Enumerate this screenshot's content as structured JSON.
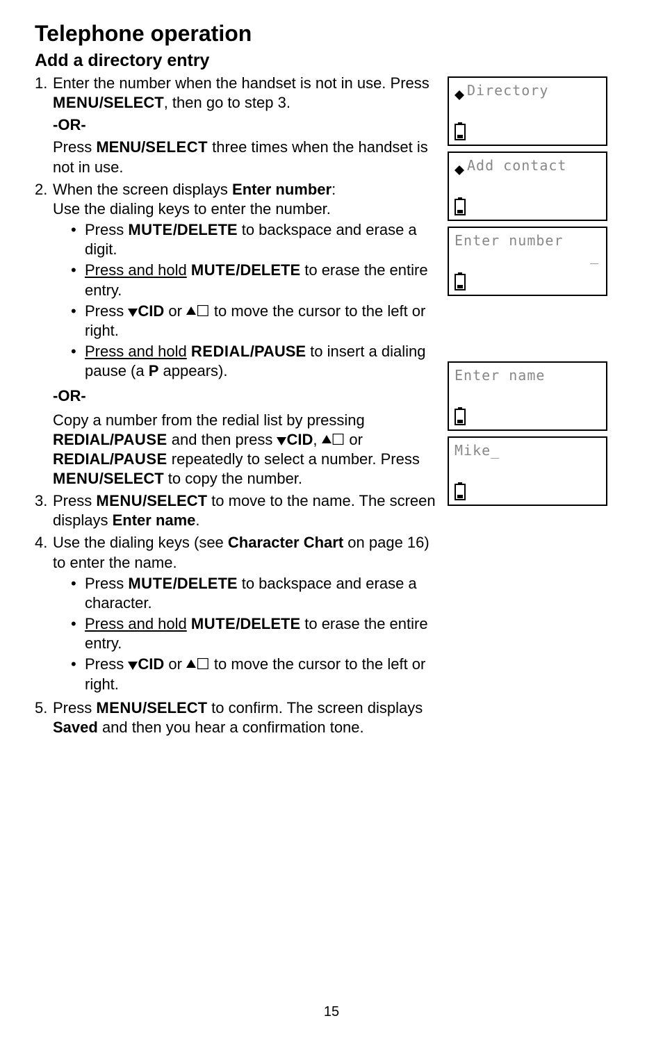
{
  "title": "Telephone operation",
  "section": "Add a directory entry",
  "steps": {
    "s1": {
      "num": "1.",
      "text_a": "Enter the number when the handset is not in use. Press ",
      "text_b": ", then go to step 3.",
      "menu_select_sc": "MENU",
      "menu_select_b": "/SELECT"
    },
    "or": "-OR-",
    "press_line_a": "Press ",
    "press_line_b": " three times when the handset is not in use.",
    "menu_b2": "MENU/",
    "menu_sc2": "SELECT",
    "s2": {
      "num": "2.",
      "text_a": "When the screen displays ",
      "text_b": ":",
      "enter_number": "Enter number",
      "use_keys": "Use the dialing keys to enter the number.",
      "bul1_a": "Press ",
      "mute_sc": "MUTE",
      "mute_b": "/DELETE",
      "bul1_b": " to backspace and erase a digit.",
      "bul2_a": "Press and hold",
      "bul2_b": " to erase the entire entry.",
      "bul3_a": "Press ",
      "cid": "CID",
      "bul3_mid": " or ",
      "bul3_b": " to move the cursor to the left or right.",
      "bul4_a": "Press and hold",
      "redial_sc": "REDIAL",
      "redial_b": "/PAUSE",
      "bul4_b": " to insert a dialing pause (a ",
      "p_letter": "P",
      "bul4_c": " appears).",
      "copy_a": "Copy a number from the redial list by pressing ",
      "copy_redial_b": "REDIAL/",
      "copy_redial_sc": "PAUSE",
      "copy_b": " and then press ",
      "copy_c": ", ",
      "copy_d": " or ",
      "copy_e": " repeatedly to select a number. Press ",
      "copy_f": " to copy the number."
    },
    "s3": {
      "num": "3.",
      "text_a": "Press ",
      "text_b": " to move to the name. The screen displays ",
      "enter_name": "Enter name",
      "text_c": "."
    },
    "s4": {
      "num": "4.",
      "text_a": "Use the dialing keys (see ",
      "char_chart": "Character Chart",
      "text_b": " on page 16) to enter the name.",
      "bul1_b": " to backspace and erase a character."
    },
    "s5": {
      "num": "5.",
      "text_a": "Press ",
      "text_b": " to confirm. The screen displays ",
      "saved": "Saved",
      "text_c": " and then you hear a confirmation tone."
    }
  },
  "lcd": {
    "l1": "Directory",
    "l2": "Add contact",
    "l3": "Enter number",
    "l4": "Enter name",
    "l5": "Mike_"
  },
  "page": "15"
}
